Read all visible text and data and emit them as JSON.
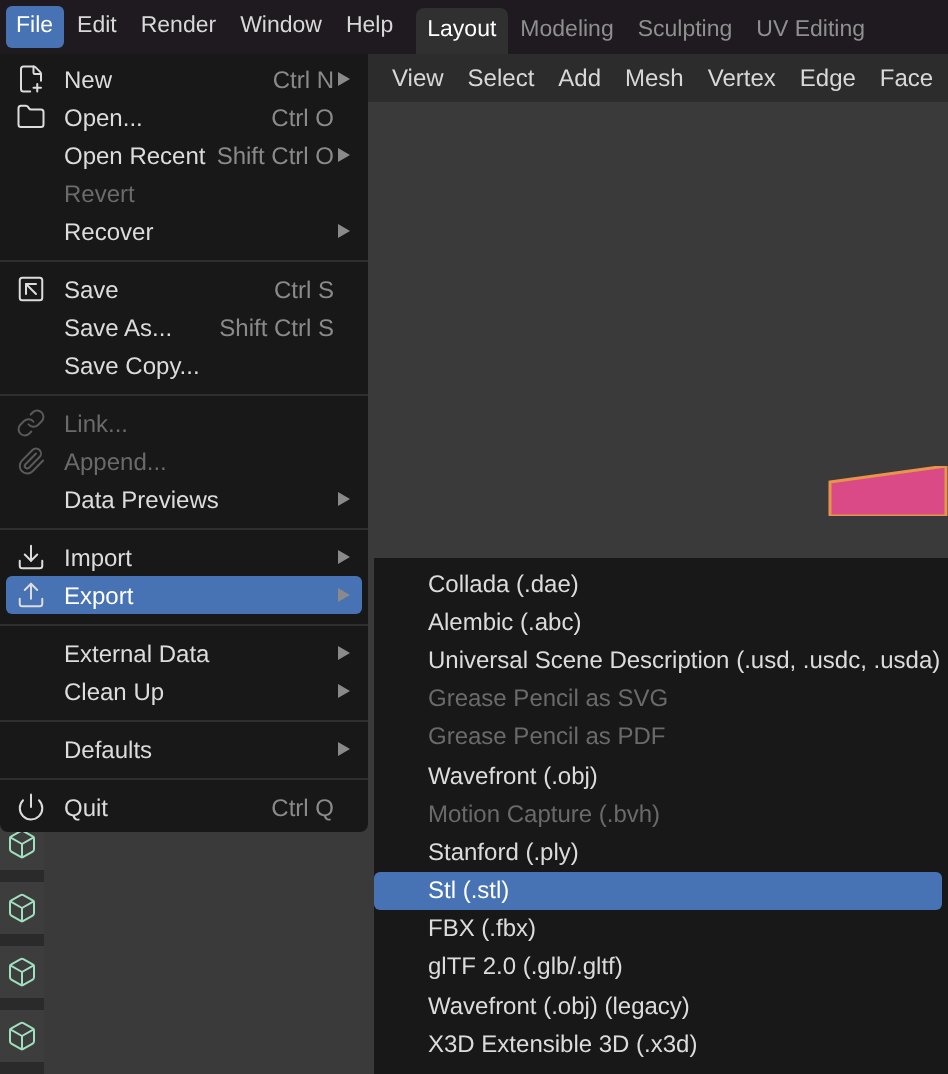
{
  "menubar": [
    {
      "label": "File",
      "selected": true
    },
    {
      "label": "Edit",
      "selected": false
    },
    {
      "label": "Render",
      "selected": false
    },
    {
      "label": "Window",
      "selected": false
    },
    {
      "label": "Help",
      "selected": false
    }
  ],
  "workspace_tabs": [
    {
      "label": "Layout",
      "selected": true
    },
    {
      "label": "Modeling",
      "selected": false
    },
    {
      "label": "Sculpting",
      "selected": false
    },
    {
      "label": "UV Editing",
      "selected": false
    }
  ],
  "viewport_header": [
    "View",
    "Select",
    "Add",
    "Mesh",
    "Vertex",
    "Edge",
    "Face"
  ],
  "file_menu": [
    {
      "kind": "item",
      "label": "New",
      "shortcut": "Ctrl N",
      "submenu": true,
      "disabled": false,
      "selected": false
    },
    {
      "kind": "item",
      "label": "Open...",
      "shortcut": "Ctrl O",
      "submenu": false,
      "disabled": false,
      "selected": false
    },
    {
      "kind": "item",
      "label": "Open Recent",
      "shortcut": "Shift Ctrl O",
      "submenu": true,
      "disabled": false,
      "selected": false
    },
    {
      "kind": "item",
      "label": "Revert",
      "submenu": false,
      "disabled": true,
      "selected": false
    },
    {
      "kind": "item",
      "label": "Recover",
      "submenu": true,
      "disabled": false,
      "selected": false
    },
    {
      "kind": "separator"
    },
    {
      "kind": "item",
      "label": "Save",
      "shortcut": "Ctrl S",
      "submenu": false,
      "disabled": false,
      "selected": false
    },
    {
      "kind": "item",
      "label": "Save As...",
      "shortcut": "Shift Ctrl S",
      "submenu": false,
      "disabled": false,
      "selected": false
    },
    {
      "kind": "item",
      "label": "Save Copy...",
      "submenu": false,
      "disabled": false,
      "selected": false
    },
    {
      "kind": "separator"
    },
    {
      "kind": "item",
      "label": "Link...",
      "submenu": false,
      "disabled": true,
      "selected": false
    },
    {
      "kind": "item",
      "label": "Append...",
      "submenu": false,
      "disabled": true,
      "selected": false
    },
    {
      "kind": "item",
      "label": "Data Previews",
      "submenu": true,
      "disabled": false,
      "selected": false
    },
    {
      "kind": "separator"
    },
    {
      "kind": "item",
      "label": "Import",
      "submenu": true,
      "disabled": false,
      "selected": false
    },
    {
      "kind": "item",
      "label": "Export",
      "submenu": true,
      "disabled": false,
      "selected": true
    },
    {
      "kind": "separator"
    },
    {
      "kind": "item",
      "label": "External Data",
      "submenu": true,
      "disabled": false,
      "selected": false
    },
    {
      "kind": "item",
      "label": "Clean Up",
      "submenu": true,
      "disabled": false,
      "selected": false
    },
    {
      "kind": "separator"
    },
    {
      "kind": "item",
      "label": "Defaults",
      "submenu": true,
      "disabled": false,
      "selected": false
    },
    {
      "kind": "separator"
    },
    {
      "kind": "item",
      "label": "Quit",
      "shortcut": "Ctrl Q",
      "submenu": false,
      "disabled": false,
      "selected": false
    }
  ],
  "export_menu": [
    {
      "label": "Collada (.dae)",
      "disabled": false,
      "selected": false
    },
    {
      "label": "Alembic (.abc)",
      "disabled": false,
      "selected": false
    },
    {
      "label": "Universal Scene Description (.usd, .usdc, .usda)",
      "disabled": false,
      "selected": false
    },
    {
      "label": "Grease Pencil as SVG",
      "disabled": true,
      "selected": false
    },
    {
      "label": "Grease Pencil as PDF",
      "disabled": true,
      "selected": false
    },
    {
      "label": "Wavefront (.obj)",
      "disabled": false,
      "selected": false
    },
    {
      "label": "Motion Capture (.bvh)",
      "disabled": true,
      "selected": false
    },
    {
      "label": "Stanford (.ply)",
      "disabled": false,
      "selected": false
    },
    {
      "label": "Stl (.stl)",
      "disabled": false,
      "selected": true
    },
    {
      "label": "FBX (.fbx)",
      "disabled": false,
      "selected": false
    },
    {
      "label": "glTF 2.0 (.glb/.gltf)",
      "disabled": false,
      "selected": false
    },
    {
      "label": "Wavefront (.obj) (legacy)",
      "disabled": false,
      "selected": false
    },
    {
      "label": "X3D Extensible 3D (.x3d)",
      "disabled": false,
      "selected": false
    }
  ]
}
